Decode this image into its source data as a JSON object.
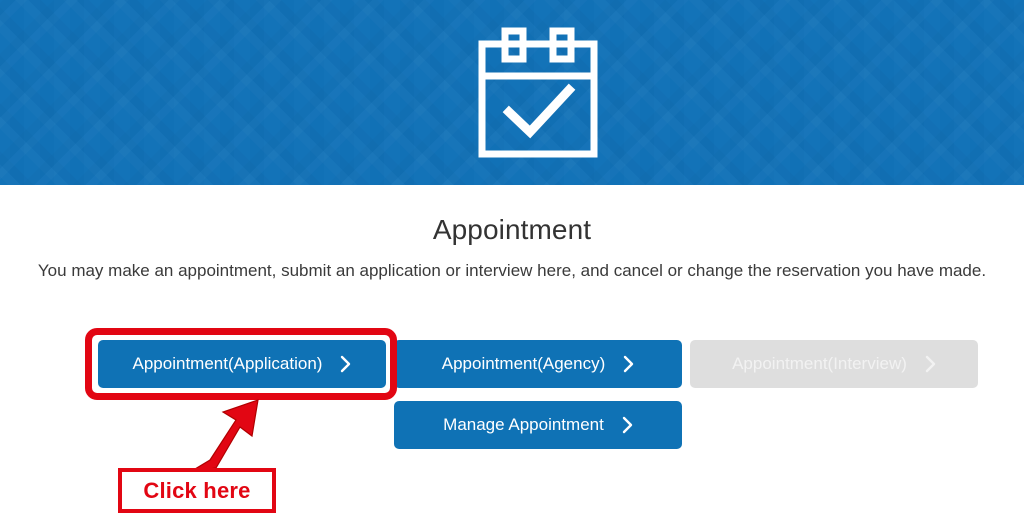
{
  "banner": {
    "background_color": "#1272b8",
    "icon": "calendar-check-icon"
  },
  "main": {
    "title": "Appointment",
    "description": "You may make an appointment, submit an application or interview here, and cancel or change the reservation you have made."
  },
  "buttons": [
    {
      "id": "appointment-application",
      "label": "Appointment(Application)",
      "chevron": "chevron-right-icon",
      "state": "enabled",
      "color": "#0f72b5"
    },
    {
      "id": "appointment-agency",
      "label": "Appointment(Agency)",
      "chevron": "chevron-right-icon",
      "state": "enabled",
      "color": "#0f72b5"
    },
    {
      "id": "appointment-interview",
      "label": "Appointment(Interview)",
      "chevron": "chevron-right-icon",
      "state": "disabled",
      "color": "#dedede"
    },
    {
      "id": "manage-appointment",
      "label": "Manage Appointment",
      "chevron": "chevron-right-icon",
      "state": "enabled",
      "color": "#0f72b5"
    }
  ],
  "annotation": {
    "highlight_color": "#e20613",
    "callout_label": "Click here",
    "arrow": "arrow-up-right-icon"
  }
}
